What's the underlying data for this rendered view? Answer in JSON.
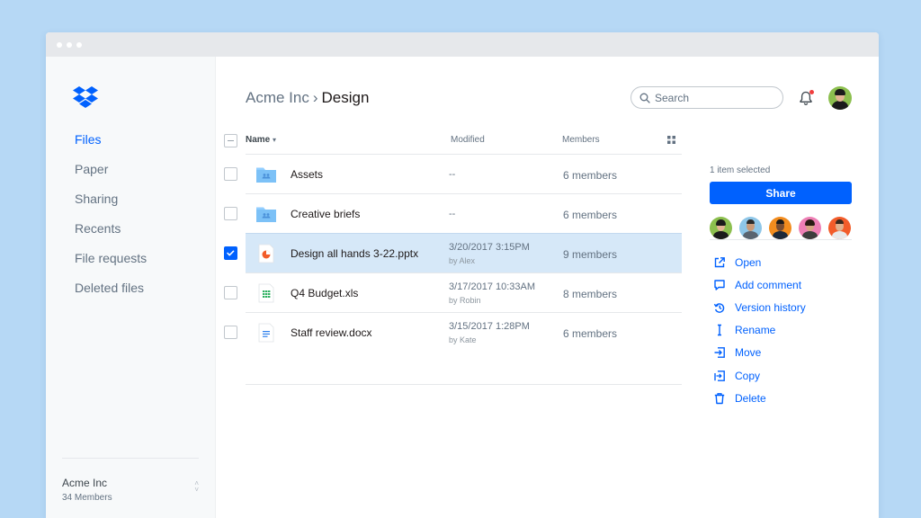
{
  "colors": {
    "accent": "#0061fe",
    "background": "#b6d8f5",
    "selected_row": "#d6e8f8",
    "notification": "#f03e3e"
  },
  "sidebar": {
    "logo": "dropbox-logo",
    "items": [
      {
        "label": "Files",
        "active": true
      },
      {
        "label": "Paper",
        "active": false
      },
      {
        "label": "Sharing",
        "active": false
      },
      {
        "label": "Recents",
        "active": false
      },
      {
        "label": "File requests",
        "active": false
      },
      {
        "label": "Deleted files",
        "active": false
      }
    ],
    "team": {
      "name": "Acme Inc",
      "members": "34 Members"
    }
  },
  "header": {
    "breadcrumb": {
      "root": "Acme Inc",
      "separator": "›",
      "current": "Design"
    },
    "search": {
      "placeholder": "Search",
      "value": ""
    },
    "notification_icon": "bell-icon",
    "has_notification": true
  },
  "table": {
    "columns": {
      "name": "Name",
      "sort_indicator": "▾",
      "modified": "Modified",
      "members": "Members"
    },
    "rows": [
      {
        "name": "Assets",
        "type": "folder",
        "modified": "--",
        "by": "",
        "members": "6 members",
        "selected": false
      },
      {
        "name": "Creative briefs",
        "type": "folder",
        "modified": "--",
        "by": "",
        "members": "6 members",
        "selected": false
      },
      {
        "name": "Design all hands 3-22.pptx",
        "type": "presentation",
        "modified": "3/20/2017 3:15PM",
        "by": "by Alex",
        "members": "9 members",
        "selected": true
      },
      {
        "name": "Q4 Budget.xls",
        "type": "spreadsheet",
        "modified": "3/17/2017 10:33AM",
        "by": "by Robin",
        "members": "8 members",
        "selected": false
      },
      {
        "name": "Staff review.docx",
        "type": "document",
        "modified": "3/15/2017 1:28PM",
        "by": "by Kate",
        "members": "6 members",
        "selected": false
      }
    ]
  },
  "panel": {
    "selection": "1 item selected",
    "share_label": "Share",
    "members_count": 5,
    "actions": [
      {
        "label": "Open",
        "icon": "open-external-icon"
      },
      {
        "label": "Add comment",
        "icon": "comment-icon"
      },
      {
        "label": "Version history",
        "icon": "version-history-icon"
      },
      {
        "label": "Rename",
        "icon": "rename-cursor-icon"
      },
      {
        "label": "Move",
        "icon": "move-icon"
      },
      {
        "label": "Copy",
        "icon": "copy-icon"
      },
      {
        "label": "Delete",
        "icon": "trash-icon"
      }
    ]
  }
}
